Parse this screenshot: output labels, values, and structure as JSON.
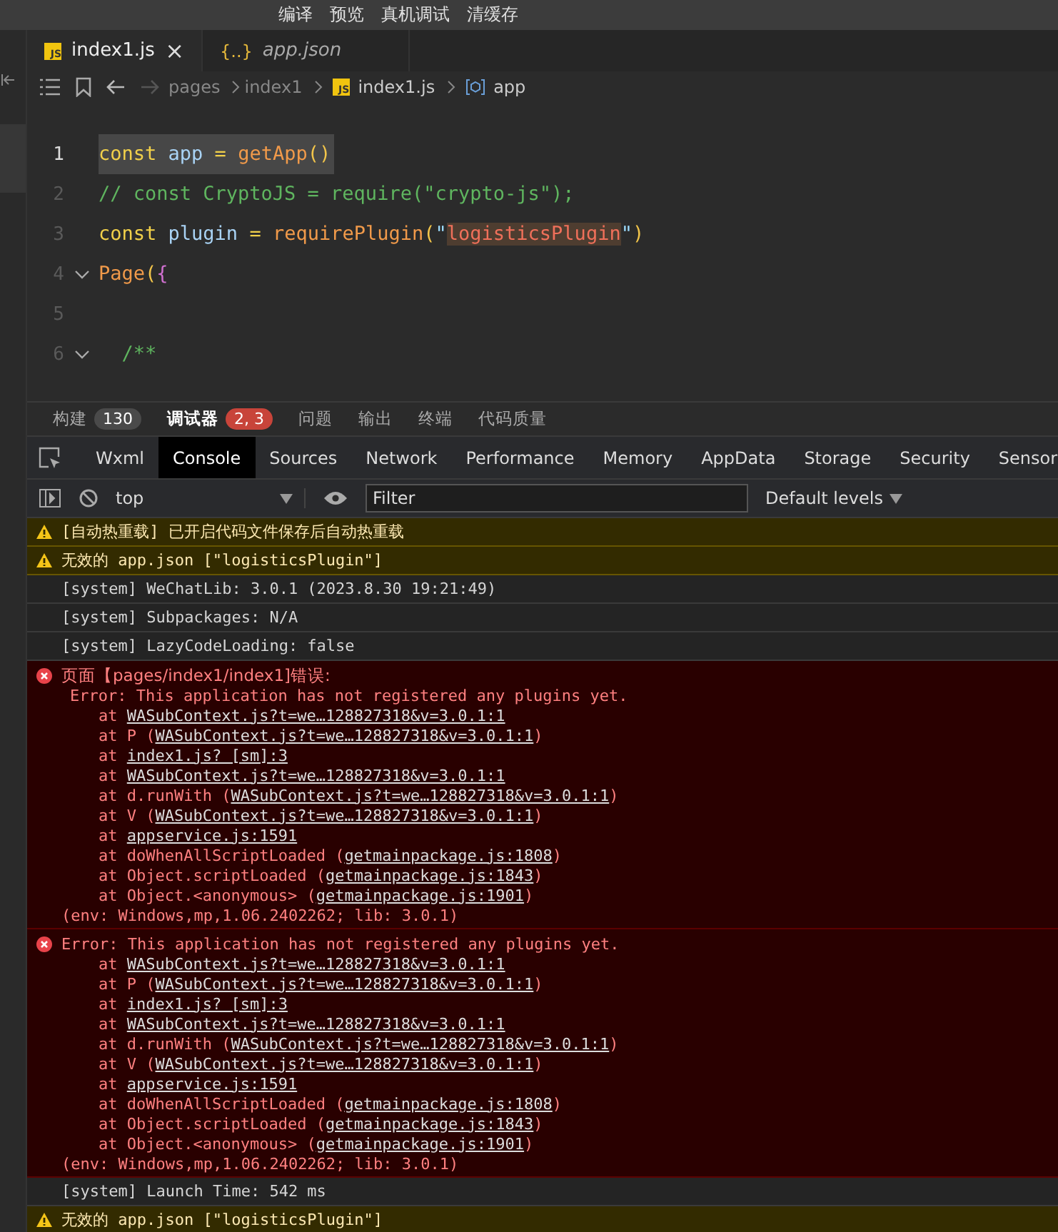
{
  "menu": [
    "编译",
    "预览",
    "真机调试",
    "清缓存"
  ],
  "editor_tabs": [
    {
      "icon": "JS",
      "label": "index1.js",
      "selected": true,
      "preview": false,
      "close": "×"
    },
    {
      "icon": "{..}",
      "label": "app.json",
      "selected": false,
      "preview": true
    }
  ],
  "breadcrumb": [
    {
      "kind": "folder",
      "label": "pages"
    },
    {
      "kind": "folder",
      "label": "index1"
    },
    {
      "kind": "file",
      "icon": "JS",
      "label": "index1.js"
    },
    {
      "kind": "symbol",
      "label": "app"
    }
  ],
  "code": [
    {
      "number": "1",
      "current": true,
      "fold": false,
      "tokens": [
        {
          "kind": "kw",
          "t": "const "
        },
        {
          "kind": "var",
          "t": "app "
        },
        {
          "kind": "op",
          "t": "= "
        },
        {
          "kind": "fn",
          "t": "getApp"
        },
        {
          "kind": "paren",
          "t": "()"
        }
      ]
    },
    {
      "number": "2",
      "current": false,
      "fold": false,
      "tokens": [
        {
          "kind": "comment",
          "t": "// const CryptoJS = require(\"crypto-js\");"
        }
      ]
    },
    {
      "number": "3",
      "current": false,
      "fold": false,
      "tokens": [
        {
          "kind": "kw",
          "t": "const "
        },
        {
          "kind": "var",
          "t": "plugin "
        },
        {
          "kind": "op",
          "t": "= "
        },
        {
          "kind": "fn",
          "t": "requirePlugin"
        },
        {
          "kind": "paren",
          "t": "("
        },
        {
          "kind": "quote",
          "t": "\""
        },
        {
          "kind": "str",
          "t": "logisticsPlugin",
          "highlighted": true
        },
        {
          "kind": "quote",
          "t": "\""
        },
        {
          "kind": "paren",
          "t": ")"
        }
      ]
    },
    {
      "number": "4",
      "current": false,
      "fold": true,
      "tokens": [
        {
          "kind": "fn",
          "t": "Page"
        },
        {
          "kind": "paren",
          "t": "("
        },
        {
          "kind": "brace",
          "t": "{"
        }
      ]
    },
    {
      "number": "5",
      "current": false,
      "fold": false
    },
    {
      "number": "6",
      "current": false,
      "fold": true,
      "tokens": [
        {
          "kind": "comment",
          "t": "  /**"
        }
      ]
    }
  ],
  "panel_tabs": [
    {
      "label": "构建",
      "selected": false,
      "badge": "130",
      "color": "#4a4a4a"
    },
    {
      "label": "调试器",
      "selected": true,
      "badge": "2, 3",
      "color": "#c8443a"
    },
    {
      "label": "问题",
      "selected": false
    },
    {
      "label": "输出",
      "selected": false
    },
    {
      "label": "终端",
      "selected": false
    },
    {
      "label": "代码质量",
      "selected": false
    }
  ],
  "devtools_tabs": [
    {
      "label": "Wxml",
      "selected": false
    },
    {
      "label": "Console",
      "selected": true
    },
    {
      "label": "Sources",
      "selected": false
    },
    {
      "label": "Network",
      "selected": false
    },
    {
      "label": "Performance",
      "selected": false
    },
    {
      "label": "Memory",
      "selected": false
    },
    {
      "label": "AppData",
      "selected": false
    },
    {
      "label": "Storage",
      "selected": false
    },
    {
      "label": "Security",
      "selected": false
    },
    {
      "label": "Sensor",
      "selected": false
    }
  ],
  "filter_bar": {
    "context": "top",
    "placeholder": "Filter",
    "levels": "Default levels"
  },
  "console": [
    {
      "kind": "warning",
      "lines": [
        {
          "kind": "title",
          "text": "[自动热重载] 已开启代码文件保存后自动热重载"
        }
      ]
    },
    {
      "kind": "warning",
      "lines": [
        {
          "kind": "title",
          "text": "无效的 app.json [\"logisticsPlugin\"]"
        }
      ]
    },
    {
      "kind": "info",
      "lines": [
        {
          "kind": "title",
          "text": "[system] WeChatLib: 3.0.1 (2023.8.30 19:21:49)"
        }
      ]
    },
    {
      "kind": "info",
      "lines": [
        {
          "kind": "title",
          "text": "[system] Subpackages: N/A"
        }
      ]
    },
    {
      "kind": "info",
      "lines": [
        {
          "kind": "title",
          "text": "[system] LazyCodeLoading: false"
        }
      ]
    },
    {
      "kind": "error",
      "lines": [
        {
          "kind": "title",
          "text": "页面【pages/index1/index1]错误:"
        },
        {
          "kind": "detail",
          "text": "Error: This application has not registered any plugins yet."
        },
        {
          "kind": "frame",
          "prefix": "at ",
          "link": "WASubContext.js?t=we…128827318&v=3.0.1:1"
        },
        {
          "kind": "frame",
          "prefix": "at P (",
          "link": "WASubContext.js?t=we…128827318&v=3.0.1:1",
          "suffix": ")"
        },
        {
          "kind": "frame",
          "prefix": "at ",
          "link": "index1.js? [sm]:3"
        },
        {
          "kind": "frame",
          "prefix": "at ",
          "link": "WASubContext.js?t=we…128827318&v=3.0.1:1"
        },
        {
          "kind": "frame",
          "prefix": "at d.runWith (",
          "link": "WASubContext.js?t=we…128827318&v=3.0.1:1",
          "suffix": ")"
        },
        {
          "kind": "frame",
          "prefix": "at V (",
          "link": "WASubContext.js?t=we…128827318&v=3.0.1:1",
          "suffix": ")"
        },
        {
          "kind": "frame",
          "prefix": "at ",
          "link": "appservice.js:1591"
        },
        {
          "kind": "frame",
          "prefix": "at doWhenAllScriptLoaded (",
          "link": "getmainpackage.js:1808",
          "suffix": ")"
        },
        {
          "kind": "frame",
          "prefix": "at Object.scriptLoaded (",
          "link": "getmainpackage.js:1843",
          "suffix": ")"
        },
        {
          "kind": "frame",
          "prefix": "at Object.<anonymous> (",
          "link": "getmainpackage.js:1901",
          "suffix": ")"
        },
        {
          "kind": "env",
          "text": "(env: Windows,mp,1.06.2402262; lib: 3.0.1)"
        }
      ]
    },
    {
      "kind": "error",
      "lines": [
        {
          "kind": "title",
          "text": "Error: This application has not registered any plugins yet."
        },
        {
          "kind": "frame",
          "prefix": "at ",
          "link": "WASubContext.js?t=we…128827318&v=3.0.1:1"
        },
        {
          "kind": "frame",
          "prefix": "at P (",
          "link": "WASubContext.js?t=we…128827318&v=3.0.1:1",
          "suffix": ")"
        },
        {
          "kind": "frame",
          "prefix": "at ",
          "link": "index1.js? [sm]:3"
        },
        {
          "kind": "frame",
          "prefix": "at ",
          "link": "WASubContext.js?t=we…128827318&v=3.0.1:1"
        },
        {
          "kind": "frame",
          "prefix": "at d.runWith (",
          "link": "WASubContext.js?t=we…128827318&v=3.0.1:1",
          "suffix": ")"
        },
        {
          "kind": "frame",
          "prefix": "at V (",
          "link": "WASubContext.js?t=we…128827318&v=3.0.1:1",
          "suffix": ")"
        },
        {
          "kind": "frame",
          "prefix": "at ",
          "link": "appservice.js:1591"
        },
        {
          "kind": "frame",
          "prefix": "at doWhenAllScriptLoaded (",
          "link": "getmainpackage.js:1808",
          "suffix": ")"
        },
        {
          "kind": "frame",
          "prefix": "at Object.scriptLoaded (",
          "link": "getmainpackage.js:1843",
          "suffix": ")"
        },
        {
          "kind": "frame",
          "prefix": "at Object.<anonymous> (",
          "link": "getmainpackage.js:1901",
          "suffix": ")"
        },
        {
          "kind": "env",
          "text": "(env: Windows,mp,1.06.2402262; lib: 3.0.1)"
        }
      ]
    },
    {
      "kind": "info",
      "lines": [
        {
          "kind": "title",
          "text": "[system] Launch Time: 542 ms"
        }
      ]
    },
    {
      "kind": "warning",
      "lines": [
        {
          "kind": "title",
          "text": "无效的 app.json [\"logisticsPlugin\"]"
        }
      ]
    }
  ]
}
